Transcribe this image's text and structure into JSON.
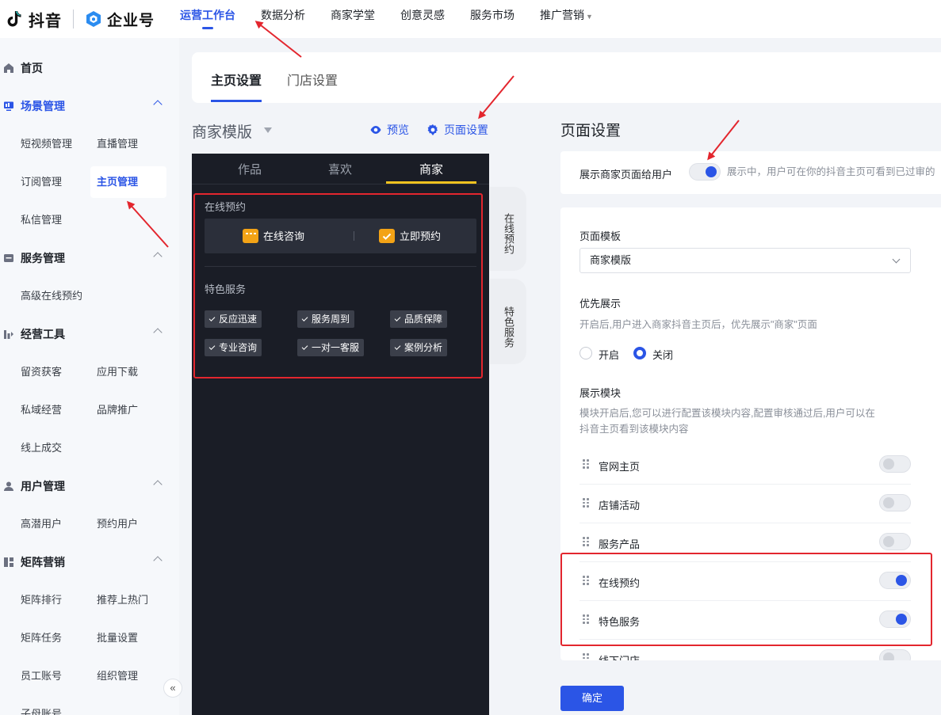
{
  "topbar": {
    "brand": "抖音",
    "sub_brand": "企业号",
    "nav": [
      {
        "label": "运营工作台",
        "active": true
      },
      {
        "label": "数据分析"
      },
      {
        "label": "商家学堂"
      },
      {
        "label": "创意灵感"
      },
      {
        "label": "服务市场"
      },
      {
        "label": "推广营销"
      }
    ]
  },
  "sidebar": {
    "home": "首页",
    "groups": [
      {
        "label": "场景管理",
        "items": [
          "短视频管理",
          "直播管理",
          "订阅管理",
          "主页管理",
          "私信管理"
        ],
        "active_item": "主页管理"
      },
      {
        "label": "服务管理",
        "items": [
          "高级在线预约"
        ]
      },
      {
        "label": "经营工具",
        "items": [
          "留资获客",
          "应用下载",
          "私域经营",
          "品牌推广",
          "线上成交"
        ]
      },
      {
        "label": "用户管理",
        "items": [
          "高潜用户",
          "预约用户"
        ]
      },
      {
        "label": "矩阵营销",
        "items": [
          "矩阵排行",
          "推荐上热门",
          "矩阵任务",
          "批量设置",
          "员工账号",
          "组织管理",
          "子母账号"
        ]
      }
    ],
    "collapse_icon": "«"
  },
  "tabs": {
    "items": [
      "主页设置",
      "门店设置"
    ],
    "active": 0
  },
  "preview": {
    "template_name": "商家模版",
    "preview_label": "预览",
    "page_settings_label": "页面设置",
    "phone_tabs": [
      "作品",
      "喜欢",
      "商家"
    ],
    "online_booking_title": "在线预约",
    "actions": [
      "在线咨询",
      "立即预约"
    ],
    "featured_title": "特色服务",
    "chips": [
      "反应迅速",
      "服务周到",
      "品质保障",
      "专业咨询",
      "一对一客服",
      "案例分析"
    ],
    "side_tabs": [
      "在线预约",
      "特色服务"
    ]
  },
  "settings": {
    "title": "页面设置",
    "show_to_users_label": "展示商家页面给用户",
    "show_to_users_hint": "展示中，用户可在你的抖音主页可看到已过审的",
    "show_to_users_on": true,
    "template_label": "页面模板",
    "template_value": "商家模版",
    "priority_label": "优先展示",
    "priority_hint": "开启后,用户进入商家抖音主页后，优先展示\"商家\"页面",
    "priority_options": [
      "开启",
      "关闭"
    ],
    "priority_selected": "关闭",
    "modules_label": "展示模块",
    "modules_hint_1": "模块开启后,您可以进行配置该模块内容,配置审核通过后,用户可以在",
    "modules_hint_2": "抖音主页看到该模块内容",
    "modules": [
      {
        "name": "官网主页",
        "on": false
      },
      {
        "name": "店铺活动",
        "on": false
      },
      {
        "name": "服务产品",
        "on": false
      },
      {
        "name": "在线预约",
        "on": true
      },
      {
        "name": "特色服务",
        "on": true
      },
      {
        "name": "线下门店",
        "on": false
      }
    ],
    "confirm_label": "确定"
  },
  "colors": {
    "accent": "#2b55e6",
    "annotation": "#e3262e",
    "phone_bg": "#1a1d26"
  }
}
